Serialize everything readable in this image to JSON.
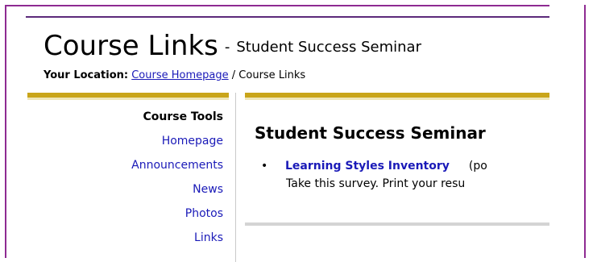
{
  "header": {
    "title": "Course Links",
    "separator": "-",
    "subtitle": "Student Success Seminar"
  },
  "breadcrumb": {
    "label": "Your Location:",
    "home_link": "Course Homepage",
    "divider": "/",
    "current": "Course Links"
  },
  "sidebar": {
    "heading": "Course Tools",
    "items": [
      {
        "label": "Homepage"
      },
      {
        "label": "Announcements"
      },
      {
        "label": "News"
      },
      {
        "label": "Photos"
      },
      {
        "label": "Links"
      }
    ]
  },
  "main": {
    "section_title": "Student Success Seminar",
    "links": [
      {
        "bullet": "•",
        "title": "Learning Styles Inventory",
        "note": "(po",
        "description": "Take this survey.  Print your resu"
      }
    ]
  },
  "colors": {
    "frame": "#8e2b92",
    "gold_bar": "#c9a51a",
    "link": "#1a1ab8"
  }
}
